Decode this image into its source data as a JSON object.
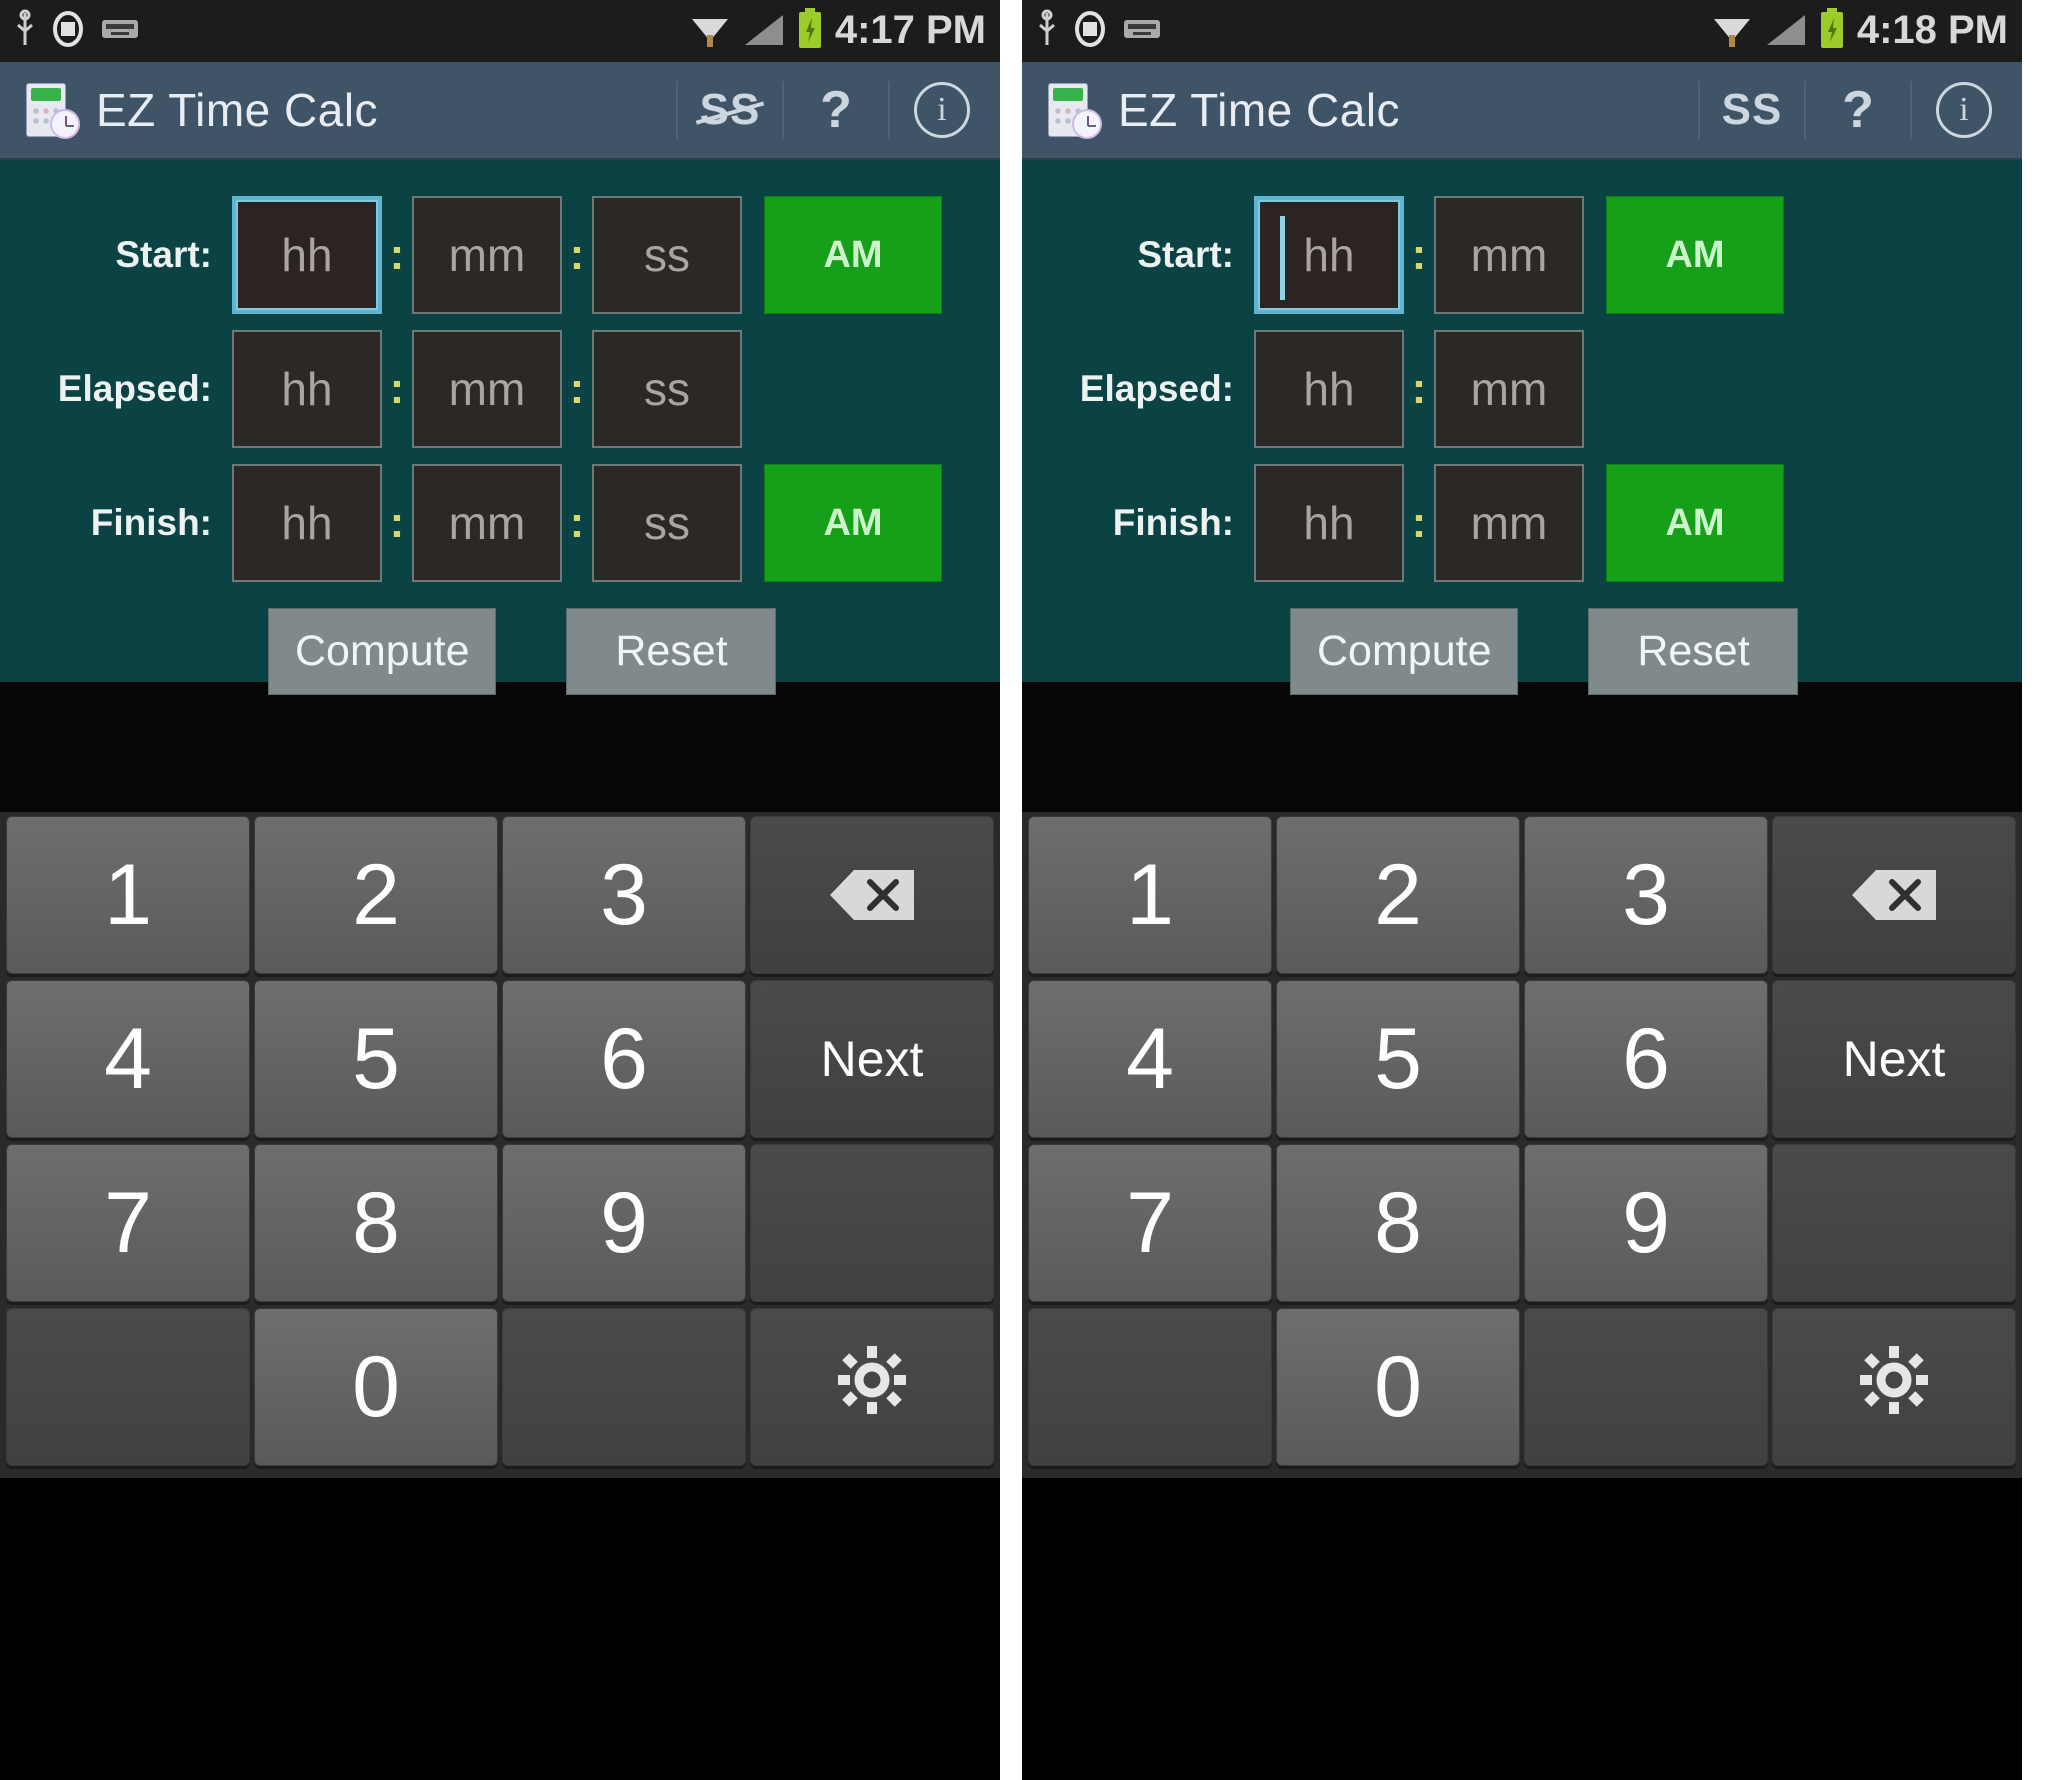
{
  "panels": [
    {
      "id": "left",
      "statusbar": {
        "time": "4:17 PM",
        "icons": [
          "usb-debug-icon",
          "alarm-icon",
          "keyboard-icon",
          "wifi-icon",
          "signal-icon",
          "battery-icon"
        ]
      },
      "actionbar": {
        "title": "EZ Time Calc",
        "app_icon": "calculator-clock-icon",
        "seconds_toggle_label": "SS",
        "seconds_toggle_struck": true,
        "help_label": "?",
        "info_label": "i"
      },
      "form": {
        "rows": [
          {
            "label": "Start:",
            "fields": [
              {
                "name": "hh",
                "placeholder": "hh",
                "focused": true,
                "caret": false
              },
              {
                "name": "mm",
                "placeholder": "mm",
                "focused": false,
                "caret": false
              },
              {
                "name": "ss",
                "placeholder": "ss",
                "focused": false,
                "caret": false
              }
            ],
            "ampm": "AM"
          },
          {
            "label": "Elapsed:",
            "fields": [
              {
                "name": "hh",
                "placeholder": "hh",
                "focused": false,
                "caret": false
              },
              {
                "name": "mm",
                "placeholder": "mm",
                "focused": false,
                "caret": false
              },
              {
                "name": "ss",
                "placeholder": "ss",
                "focused": false,
                "caret": false
              }
            ],
            "ampm": null
          },
          {
            "label": "Finish:",
            "fields": [
              {
                "name": "hh",
                "placeholder": "hh",
                "focused": false,
                "caret": false
              },
              {
                "name": "mm",
                "placeholder": "mm",
                "focused": false,
                "caret": false
              },
              {
                "name": "ss",
                "placeholder": "ss",
                "focused": false,
                "caret": false
              }
            ],
            "ampm": "AM"
          }
        ],
        "compute_label": "Compute",
        "reset_label": "Reset",
        "separator": ":"
      },
      "keypad": {
        "rows": [
          [
            {
              "label": "1",
              "type": "digit"
            },
            {
              "label": "2",
              "type": "digit"
            },
            {
              "label": "3",
              "type": "digit"
            },
            {
              "label": "",
              "type": "backspace"
            }
          ],
          [
            {
              "label": "4",
              "type": "digit"
            },
            {
              "label": "5",
              "type": "digit"
            },
            {
              "label": "6",
              "type": "digit"
            },
            {
              "label": "Next",
              "type": "action"
            }
          ],
          [
            {
              "label": "7",
              "type": "digit"
            },
            {
              "label": "8",
              "type": "digit"
            },
            {
              "label": "9",
              "type": "digit"
            },
            {
              "label": "",
              "type": "blank"
            }
          ],
          [
            {
              "label": "",
              "type": "blank"
            },
            {
              "label": "0",
              "type": "digit"
            },
            {
              "label": "",
              "type": "blank"
            },
            {
              "label": "",
              "type": "settings"
            }
          ]
        ]
      }
    },
    {
      "id": "right",
      "statusbar": {
        "time": "4:18 PM",
        "icons": [
          "usb-debug-icon",
          "alarm-icon",
          "keyboard-icon",
          "wifi-icon",
          "signal-icon",
          "battery-icon"
        ]
      },
      "actionbar": {
        "title": "EZ Time Calc",
        "app_icon": "calculator-clock-icon",
        "seconds_toggle_label": "SS",
        "seconds_toggle_struck": false,
        "help_label": "?",
        "info_label": "i"
      },
      "form": {
        "rows": [
          {
            "label": "Start:",
            "fields": [
              {
                "name": "hh",
                "placeholder": "hh",
                "focused": true,
                "caret": true
              },
              {
                "name": "mm",
                "placeholder": "mm",
                "focused": false,
                "caret": false
              }
            ],
            "ampm": "AM"
          },
          {
            "label": "Elapsed:",
            "fields": [
              {
                "name": "hh",
                "placeholder": "hh",
                "focused": false,
                "caret": false
              },
              {
                "name": "mm",
                "placeholder": "mm",
                "focused": false,
                "caret": false
              }
            ],
            "ampm": null
          },
          {
            "label": "Finish:",
            "fields": [
              {
                "name": "hh",
                "placeholder": "hh",
                "focused": false,
                "caret": false
              },
              {
                "name": "mm",
                "placeholder": "mm",
                "focused": false,
                "caret": false
              }
            ],
            "ampm": "AM"
          }
        ],
        "compute_label": "Compute",
        "reset_label": "Reset",
        "separator": ":"
      },
      "keypad": {
        "rows": [
          [
            {
              "label": "1",
              "type": "digit"
            },
            {
              "label": "2",
              "type": "digit"
            },
            {
              "label": "3",
              "type": "digit"
            },
            {
              "label": "",
              "type": "backspace"
            }
          ],
          [
            {
              "label": "4",
              "type": "digit"
            },
            {
              "label": "5",
              "type": "digit"
            },
            {
              "label": "6",
              "type": "digit"
            },
            {
              "label": "Next",
              "type": "action"
            }
          ],
          [
            {
              "label": "7",
              "type": "digit"
            },
            {
              "label": "8",
              "type": "digit"
            },
            {
              "label": "9",
              "type": "digit"
            },
            {
              "label": "",
              "type": "blank"
            }
          ],
          [
            {
              "label": "",
              "type": "blank"
            },
            {
              "label": "0",
              "type": "digit"
            },
            {
              "label": "",
              "type": "blank"
            },
            {
              "label": "",
              "type": "settings"
            }
          ]
        ]
      }
    }
  ],
  "colors": {
    "action_bar": "#3f5467",
    "app_background": "#0b4244",
    "ampm_green": "#16a01a",
    "button_gray": "#808a8d",
    "field_dark": "#2b2826",
    "focus_blue": "#5fb4cf",
    "colon_yellow": "#d8d86a",
    "status_bar": "#1c1c1a",
    "keypad_bg": "#2a2a2a"
  }
}
